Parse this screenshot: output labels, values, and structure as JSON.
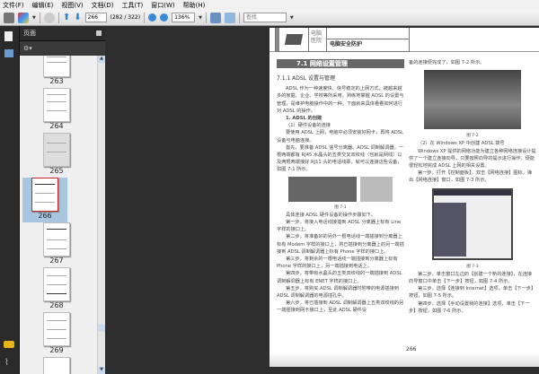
{
  "menu": [
    "文件(F)",
    "编辑(E)",
    "视图(V)",
    "文档(D)",
    "工具(T)",
    "窗口(W)",
    "帮助(H)"
  ],
  "toolbar": {
    "page_value": "266",
    "page_count": "(282 / 322)",
    "zoom_value": "136%",
    "find_placeholder": "查找"
  },
  "panel": {
    "title": "页面"
  },
  "thumbnails": [
    "263",
    "264",
    "265",
    "266",
    "267",
    "268",
    "269"
  ],
  "selected_page": "266",
  "page": {
    "chapter_line1": "电脑",
    "chapter_line2": "医院",
    "chapter_title": "电脑安全防护",
    "section_num": "7.1",
    "section_title": "网络设置管理",
    "sub": "7.1.1   ADSL 设置与管理",
    "left_paras": [
      "ADSL 作为一种速度快、信号稳定的上网方式，被越来越多的家庭、企业、学校等所采用，熟练地掌握 ADSL 的设置与管理，是维护电脑操作中的一种。下面就来具体看看如何进行对 ADSL 的操作。",
      "1. ADSL 的创建",
      "（1）硬件设备的连接",
      "要使用 ADSL 上网，电脑中必须安装好网卡，再将 ADSL 设备与电脑连接。",
      "首先，要准备 ADSL 信号分离器、ADSL 调制解调器，一根两端都有 RJ45 水晶头的五类交叉双绞线（也就是网线）以及两根两端接好 RJ11 头的电话线即，就可以连接这些设备，如图 7-1 所示。"
    ],
    "fig1": "图 7-1",
    "left_paras2": [
      "具体连接 ADSL 硬件设备的操作步骤如下。",
      "第一步，将接入电话线接插到 ADSL 分离器上标有 Line 字样的接口上。",
      "第二步，将准备好的另外一根电话线一端插接到分离器上标有 Modem 字样的接口上，将已插接到分离器上的另一端插接到 ADSL 调制解调器上标有 Phone 字样的接口上。",
      "第三步，将剩余的一根电话线一端插接到分离器上标有 Phone 字样的接口上，另一端插接到电话上。",
      "第四步，将带有水晶头的五类双绞线的一端插接到 ADSL 调制解调器上标有 ENET 字样的接口上。",
      "第五步，将购买 ADSL 调制解调器时附带的电源插接到 ADSL 调制解调器的电源插孔中。",
      "第六步，将已插接到 ADSL 调制解调器上五类双绞线的另一端插接到网卡接口上，至此 ADSL 硬件设"
    ],
    "right_top": "备的连接便完成了，如图 7-2 所示。",
    "fig2": "图 7-2",
    "right_paras": [
      "（2）在 Windows XP 中创建 ADSL 拨号",
      "Windows XP 提供的网络功能为建立各种网络连接设计提供了一个建立连接向导，只要按照向导的提示进行操作，便能很轻松地完成 ADSL 上网的相关设置。",
      "第一步，打开【控制面板】，双击【网络连接】图标，弹出【网络连接】窗口，如图 7-3 所示。"
    ],
    "fig3": "图 7-3",
    "right_paras2": [
      "第二步，单击窗口左边的【创建一个新的连接】，在连接向导窗口中单击【下一步】按钮，如图 7-4 所示。",
      "第三步，选择【连接到 Internet】选项，单击【下一步】按钮，如图 7-5 所示。",
      "第四步，选择【手动设置我的连接】选项，单击【下一步】按钮，如图 7-6 所示。"
    ],
    "page_number": "266"
  }
}
